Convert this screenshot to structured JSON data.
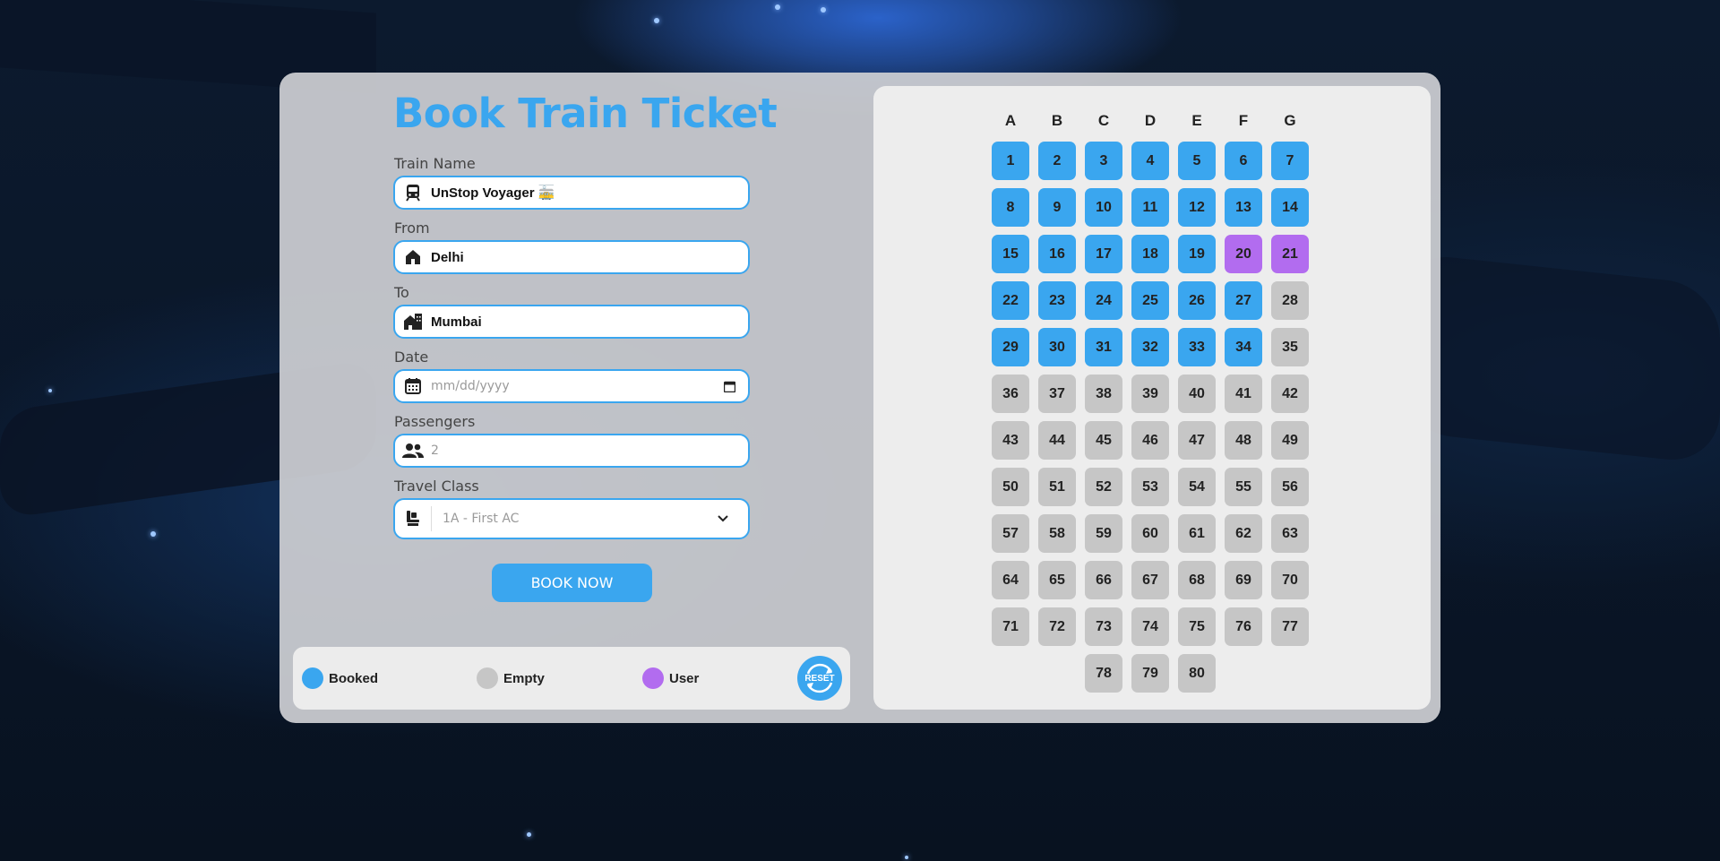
{
  "title": "Book Train Ticket",
  "form": {
    "train_name": {
      "label": "Train Name",
      "value": "UnStop Voyager 🚋",
      "icon": "train-icon"
    },
    "from": {
      "label": "From",
      "value": "Delhi",
      "icon": "home-icon"
    },
    "to": {
      "label": "To",
      "value": "Mumbai",
      "icon": "city-icon"
    },
    "date": {
      "label": "Date",
      "placeholder": "mm/dd/yyyy",
      "icon": "calendar-icon"
    },
    "passengers": {
      "label": "Passengers",
      "placeholder": "2",
      "icon": "people-icon"
    },
    "travel_class": {
      "label": "Travel Class",
      "selected": "1A - First AC",
      "icon": "seat-icon"
    },
    "book_button": "BOOK NOW"
  },
  "legend": {
    "booked": "Booked",
    "empty": "Empty",
    "user": "User",
    "reset": "RESET"
  },
  "colors": {
    "accent": "#3aa6ef",
    "booked": "#3aa6ef",
    "empty": "#c6c6c6",
    "user": "#b26cef"
  },
  "seat_columns": [
    "A",
    "B",
    "C",
    "D",
    "E",
    "F",
    "G"
  ],
  "seats": {
    "numbers": [
      1,
      2,
      3,
      4,
      5,
      6,
      7,
      8,
      9,
      10,
      11,
      12,
      13,
      14,
      15,
      16,
      17,
      18,
      19,
      20,
      21,
      22,
      23,
      24,
      25,
      26,
      27,
      28,
      29,
      30,
      31,
      32,
      33,
      34,
      35,
      36,
      37,
      38,
      39,
      40,
      41,
      42,
      43,
      44,
      45,
      46,
      47,
      48,
      49,
      50,
      51,
      52,
      53,
      54,
      55,
      56,
      57,
      58,
      59,
      60,
      61,
      62,
      63,
      64,
      65,
      66,
      67,
      68,
      69,
      70,
      71,
      72,
      73,
      74,
      75,
      76,
      77,
      78,
      79,
      80
    ],
    "booked": [
      1,
      2,
      3,
      4,
      5,
      6,
      7,
      8,
      9,
      10,
      11,
      12,
      13,
      14,
      15,
      16,
      17,
      18,
      19,
      22,
      23,
      24,
      25,
      26,
      27,
      29,
      30,
      31,
      32,
      33,
      34
    ],
    "user": [
      20,
      21
    ]
  }
}
